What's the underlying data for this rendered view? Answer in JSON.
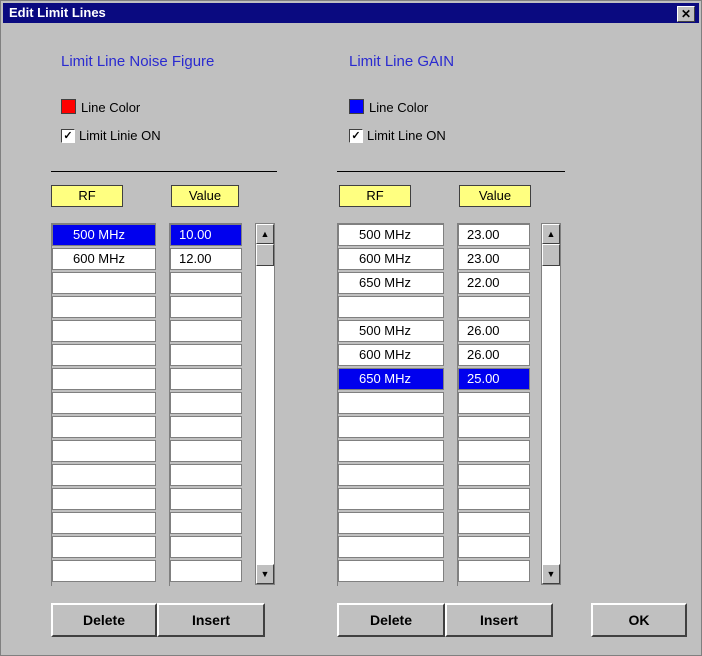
{
  "window": {
    "title": "Edit Limit Lines",
    "close_glyph": "✕"
  },
  "left": {
    "title": "Limit Line  Noise Figure",
    "line_color_label": "Line Color",
    "line_color": "#ff0000",
    "limit_on_label": "Limit Linie ON",
    "limit_on": true,
    "rf_header": "RF",
    "value_header": "Value",
    "rows": [
      {
        "rf": "500 MHz",
        "value": "10.00",
        "selected": true
      },
      {
        "rf": "600 MHz",
        "value": "12.00",
        "selected": false
      },
      {
        "rf": "",
        "value": "",
        "selected": false
      },
      {
        "rf": "",
        "value": "",
        "selected": false
      },
      {
        "rf": "",
        "value": "",
        "selected": false
      },
      {
        "rf": "",
        "value": "",
        "selected": false
      },
      {
        "rf": "",
        "value": "",
        "selected": false
      },
      {
        "rf": "",
        "value": "",
        "selected": false
      },
      {
        "rf": "",
        "value": "",
        "selected": false
      },
      {
        "rf": "",
        "value": "",
        "selected": false
      },
      {
        "rf": "",
        "value": "",
        "selected": false
      },
      {
        "rf": "",
        "value": "",
        "selected": false
      },
      {
        "rf": "",
        "value": "",
        "selected": false
      },
      {
        "rf": "",
        "value": "",
        "selected": false
      },
      {
        "rf": "",
        "value": "",
        "selected": false
      }
    ],
    "delete_label": "Delete",
    "insert_label": "Insert"
  },
  "right": {
    "title": "Limit Line   GAIN",
    "line_color_label": "Line Color",
    "line_color": "#0000ff",
    "limit_on_label": "Limit Line ON",
    "limit_on": true,
    "rf_header": "RF",
    "value_header": "Value",
    "rows": [
      {
        "rf": "500 MHz",
        "value": "23.00",
        "selected": false
      },
      {
        "rf": "600 MHz",
        "value": "23.00",
        "selected": false
      },
      {
        "rf": "650 MHz",
        "value": "22.00",
        "selected": false
      },
      {
        "rf": "",
        "value": "",
        "selected": false
      },
      {
        "rf": "500 MHz",
        "value": "26.00",
        "selected": false
      },
      {
        "rf": "600 MHz",
        "value": "26.00",
        "selected": false
      },
      {
        "rf": "650 MHz",
        "value": "25.00",
        "selected": true
      },
      {
        "rf": "",
        "value": "",
        "selected": false
      },
      {
        "rf": "",
        "value": "",
        "selected": false
      },
      {
        "rf": "",
        "value": "",
        "selected": false
      },
      {
        "rf": "",
        "value": "",
        "selected": false
      },
      {
        "rf": "",
        "value": "",
        "selected": false
      },
      {
        "rf": "",
        "value": "",
        "selected": false
      },
      {
        "rf": "",
        "value": "",
        "selected": false
      },
      {
        "rf": "",
        "value": "",
        "selected": false
      }
    ],
    "delete_label": "Delete",
    "insert_label": "Insert"
  },
  "ok_label": "OK",
  "scroll_up_glyph": "▲",
  "scroll_down_glyph": "▼",
  "check_glyph": "✓"
}
